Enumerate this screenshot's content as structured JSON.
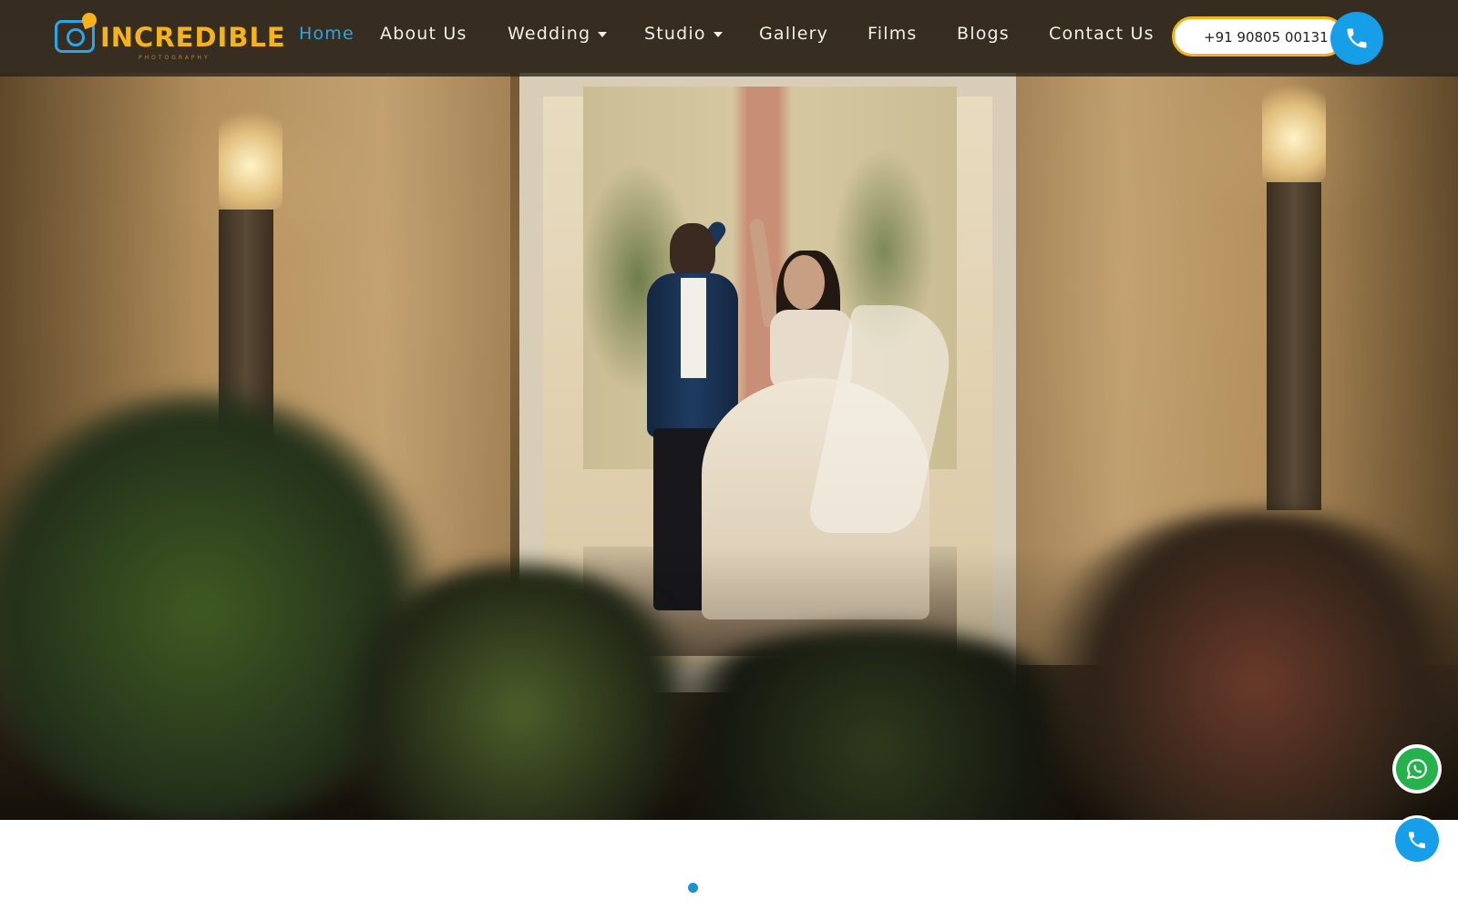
{
  "brand": {
    "name": "INCREDIBLE",
    "tagline": "PHOTOGRAPHY"
  },
  "nav": {
    "items": [
      {
        "label": "Home",
        "active": true
      },
      {
        "label": "About Us"
      },
      {
        "label": "Wedding",
        "dropdown": true
      },
      {
        "label": "Studio",
        "dropdown": true
      },
      {
        "label": "Gallery"
      },
      {
        "label": "Films"
      },
      {
        "label": "Blogs"
      },
      {
        "label": "Contact Us"
      }
    ]
  },
  "contact": {
    "phone": "+91 90805 00131",
    "icon": "phone-icon"
  },
  "floating": {
    "whatsapp_icon": "whatsapp-icon",
    "call_icon": "phone-icon"
  },
  "carousel": {
    "total_slides": 1,
    "active_slide": 1
  },
  "colors": {
    "accent": "#2aa7e8",
    "brand_yellow": "#f5b21a",
    "whatsapp": "#25b14b",
    "call": "#169ee8"
  }
}
